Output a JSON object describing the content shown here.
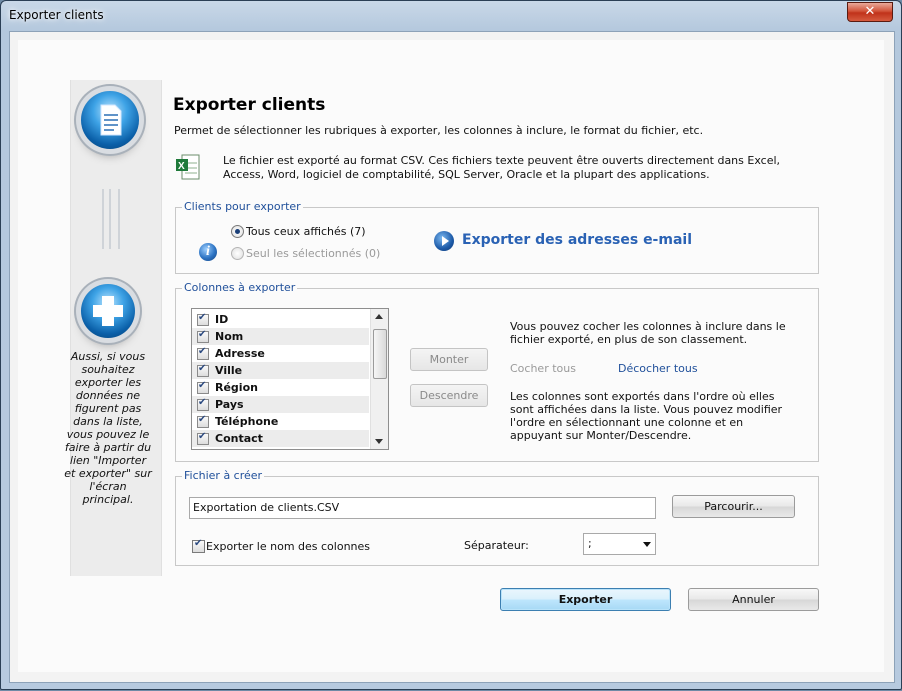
{
  "window": {
    "title": "Exporter clients",
    "close_symbol": "✕"
  },
  "sidebar": {
    "top_icon": "document-orb-icon",
    "bottom_icon": "plus-orb-icon",
    "note": "Aussi, si vous souhaitez exporter les données ne figurent pas dans la liste, vous pouvez le faire à partir du lien \"Importer et exporter\" sur l'écran principal."
  },
  "header": {
    "title": "Exporter clients",
    "subtitle": "Permet de sélectionner les rubriques à exporter, les colonnes à inclure, le format du fichier, etc.",
    "csv_icon": "excel-csv-icon",
    "csv_info": "Le fichier est exporté au format CSV. Ces fichiers texte peuvent être ouverts directement dans Excel, Access, Word, logiciel de comptabilité, SQL Server, Oracle et la plupart des applications."
  },
  "clients_group": {
    "legend": "Clients pour exporter",
    "option_all": "Tous ceux affichés (7)",
    "option_selected": "Seul les sélectionnés (0)",
    "info_icon": "info-icon",
    "email_link": "Exporter des adresses e-mail"
  },
  "columns_group": {
    "legend": "Colonnes à exporter",
    "columns": [
      {
        "label": "ID",
        "checked": true
      },
      {
        "label": "Nom",
        "checked": true
      },
      {
        "label": "Adresse",
        "checked": true
      },
      {
        "label": "Ville",
        "checked": true
      },
      {
        "label": "Région",
        "checked": true
      },
      {
        "label": "Pays",
        "checked": true
      },
      {
        "label": "Téléphone",
        "checked": true
      },
      {
        "label": "Contact",
        "checked": true
      }
    ],
    "move_up": "Monter",
    "move_down": "Descendre",
    "info_top": "Vous pouvez cocher les colonnes à inclure dans le fichier exporté, en plus de son classement.",
    "check_all": "Cocher tous",
    "uncheck_all": "Décocher tous",
    "info_bottom": "Les colonnes sont exportés dans l'ordre où elles sont affichées dans la liste. Vous pouvez modifier l'ordre en sélectionnant une colonne et en appuyant sur Monter/Descendre."
  },
  "file_group": {
    "legend": "Fichier à créer",
    "filename": "Exportation de clients.CSV",
    "browse": "Parcourir...",
    "export_headers_label": "Exporter le nom des colonnes",
    "separator_label": "Séparateur:",
    "separator_value": ";"
  },
  "actions": {
    "export": "Exporter",
    "cancel": "Annuler"
  }
}
